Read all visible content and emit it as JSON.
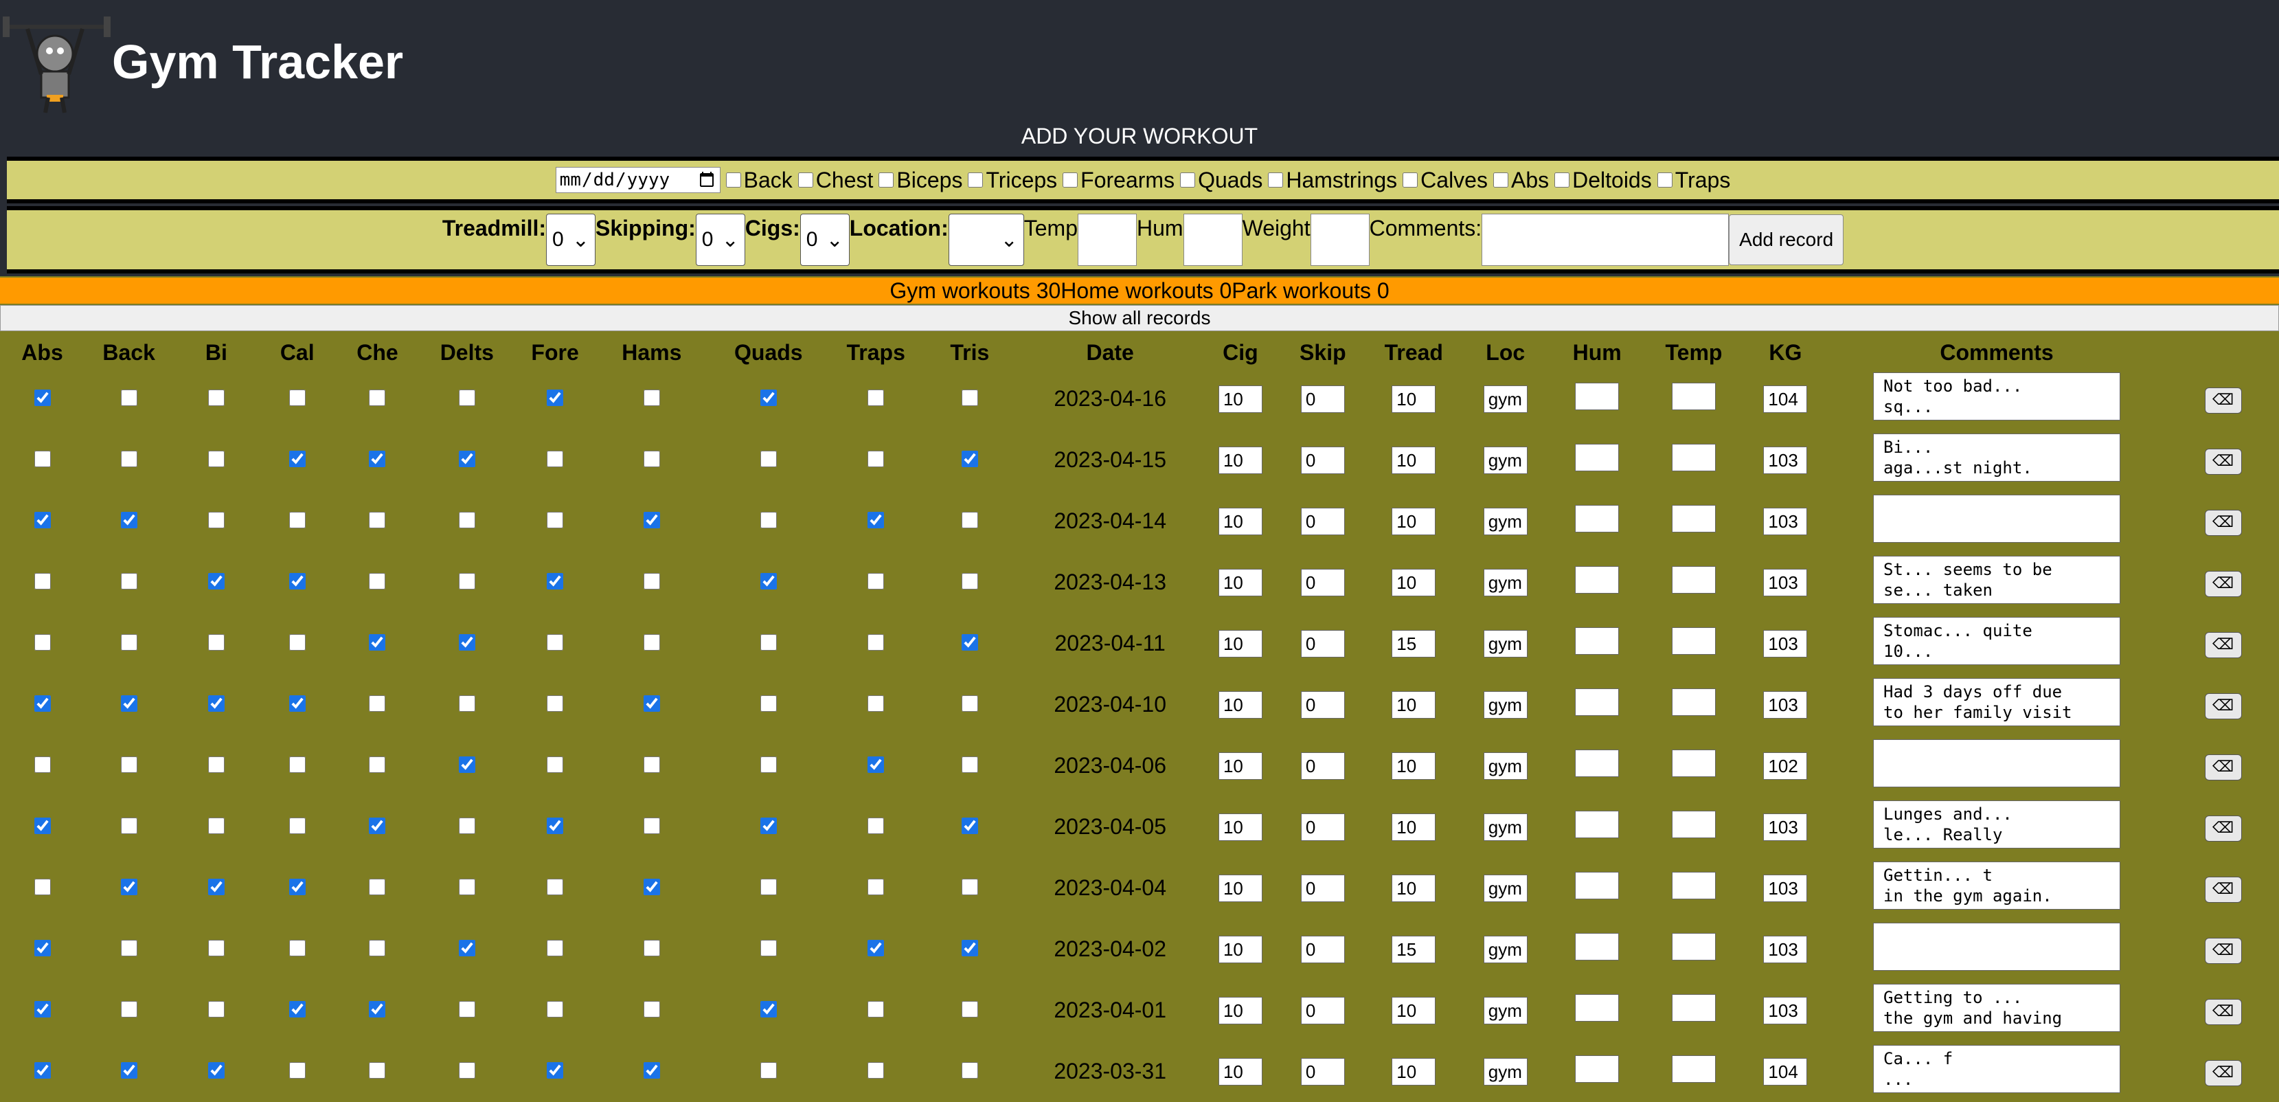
{
  "app": {
    "title": "Gym Tracker",
    "add_heading": "ADD YOUR WORKOUT"
  },
  "form": {
    "date_placeholder": "dd/mm/yyyy",
    "muscles": [
      "Back",
      "Chest",
      "Biceps",
      "Triceps",
      "Forearms",
      "Quads",
      "Hamstrings",
      "Calves",
      "Abs",
      "Deltoids",
      "Traps"
    ],
    "treadmill_label": "Treadmill:",
    "treadmill_value": "0",
    "skipping_label": "Skipping:",
    "skipping_value": "0",
    "cigs_label": "Cigs:",
    "cigs_value": "0",
    "location_label": "Location:",
    "location_value": "",
    "temp_label": "Temp",
    "hum_label": "Hum",
    "weight_label": "Weight",
    "comments_label": "Comments:",
    "add_button": "Add record"
  },
  "counts": {
    "text": "Gym workouts 30Home workouts 0Park workouts 0"
  },
  "show_all_label": "Show all records",
  "table": {
    "headers": [
      "Abs",
      "Back",
      "Bi",
      "Cal",
      "Che",
      "Delts",
      "Fore",
      "Hams",
      "Quads",
      "Traps",
      "Tris",
      "Date",
      "Cig",
      "Skip",
      "Tread",
      "Loc",
      "Hum",
      "Temp",
      "KG",
      "Comments",
      ""
    ],
    "rows": [
      {
        "checks": [
          1,
          0,
          0,
          0,
          0,
          0,
          1,
          0,
          1,
          0,
          0
        ],
        "date": "2023-04-16",
        "cig": "10",
        "skip": "0",
        "tread": "10",
        "loc": "gym",
        "kg": "104",
        "comment": "Not too bad...\nsq..."
      },
      {
        "checks": [
          0,
          0,
          0,
          1,
          1,
          1,
          0,
          0,
          0,
          0,
          1
        ],
        "date": "2023-04-15",
        "cig": "10",
        "skip": "0",
        "tread": "10",
        "loc": "gym",
        "kg": "103",
        "comment": "Bi...\naga...st night."
      },
      {
        "checks": [
          1,
          1,
          0,
          0,
          0,
          0,
          0,
          1,
          0,
          1,
          0
        ],
        "date": "2023-04-14",
        "cig": "10",
        "skip": "0",
        "tread": "10",
        "loc": "gym",
        "kg": "103",
        "comment": ""
      },
      {
        "checks": [
          0,
          0,
          1,
          1,
          0,
          0,
          1,
          0,
          1,
          0,
          0
        ],
        "date": "2023-04-13",
        "cig": "10",
        "skip": "0",
        "tread": "10",
        "loc": "gym",
        "kg": "103",
        "comment": "St... seems to be\nse... taken"
      },
      {
        "checks": [
          0,
          0,
          0,
          0,
          1,
          1,
          0,
          0,
          0,
          0,
          1
        ],
        "date": "2023-04-11",
        "cig": "10",
        "skip": "0",
        "tread": "15",
        "loc": "gym",
        "kg": "103",
        "comment": "Stomac... quite\n10..."
      },
      {
        "checks": [
          1,
          1,
          1,
          1,
          0,
          0,
          0,
          1,
          0,
          0,
          0
        ],
        "date": "2023-04-10",
        "cig": "10",
        "skip": "0",
        "tread": "10",
        "loc": "gym",
        "kg": "103",
        "comment": "Had 3 days off due\nto her family visit"
      },
      {
        "checks": [
          0,
          0,
          0,
          0,
          0,
          1,
          0,
          0,
          0,
          1,
          0
        ],
        "date": "2023-04-06",
        "cig": "10",
        "skip": "0",
        "tread": "10",
        "loc": "gym",
        "kg": "102",
        "comment": ""
      },
      {
        "checks": [
          1,
          0,
          0,
          0,
          1,
          0,
          1,
          0,
          1,
          0,
          1
        ],
        "date": "2023-04-05",
        "cig": "10",
        "skip": "0",
        "tread": "10",
        "loc": "gym",
        "kg": "103",
        "comment": "Lunges and...\nle... Really"
      },
      {
        "checks": [
          0,
          1,
          1,
          1,
          0,
          0,
          0,
          1,
          0,
          0,
          0
        ],
        "date": "2023-04-04",
        "cig": "10",
        "skip": "0",
        "tread": "10",
        "loc": "gym",
        "kg": "103",
        "comment": "Gettin... t\nin the gym again."
      },
      {
        "checks": [
          1,
          0,
          0,
          0,
          0,
          1,
          0,
          0,
          0,
          1,
          1
        ],
        "date": "2023-04-02",
        "cig": "10",
        "skip": "0",
        "tread": "15",
        "loc": "gym",
        "kg": "103",
        "comment": ""
      },
      {
        "checks": [
          1,
          0,
          0,
          1,
          1,
          0,
          0,
          0,
          1,
          0,
          0
        ],
        "date": "2023-04-01",
        "cig": "10",
        "skip": "0",
        "tread": "10",
        "loc": "gym",
        "kg": "103",
        "comment": "Getting to ...\nthe gym and having"
      },
      {
        "checks": [
          1,
          1,
          1,
          0,
          0,
          0,
          1,
          1,
          0,
          0,
          0
        ],
        "date": "2023-03-31",
        "cig": "10",
        "skip": "0",
        "tread": "10",
        "loc": "gym",
        "kg": "104",
        "comment": "Ca... f\n..."
      }
    ]
  },
  "colors": {
    "header_bg": "#282c34",
    "form_bg": "#d3d174",
    "table_bg": "#7e7d22",
    "counts_bg": "#ff9a00"
  }
}
